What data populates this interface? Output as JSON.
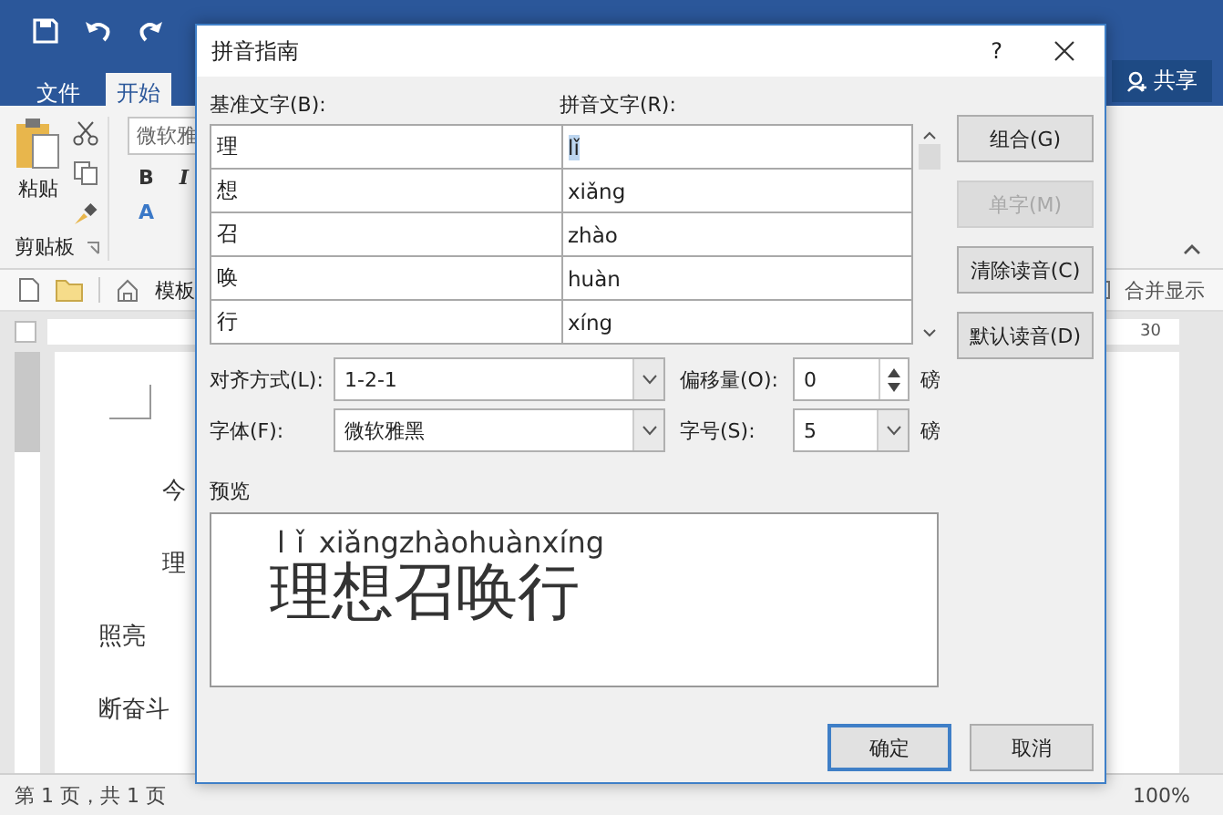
{
  "word": {
    "tabs": [
      {
        "label": "文件",
        "selected": false
      },
      {
        "label": "开始",
        "selected": true
      }
    ],
    "share": "共享",
    "paste": "粘贴",
    "clipboard_group": "剪贴板",
    "font_box": "微软雅",
    "format_buttons": [
      "B",
      "I",
      "A"
    ],
    "template": "模板",
    "merge_display": "合并显示",
    "ruler_number": "30",
    "document_lines": [
      "今",
      "理",
      "照亮",
      "断奋斗"
    ],
    "status_page": "第 1 页，共 1 页",
    "zoom": "100%"
  },
  "dialog": {
    "title": "拼音指南",
    "help": "?",
    "base_label": "基准文字(B):",
    "pinyin_label": "拼音文字(R):",
    "rows": [
      {
        "base": "理",
        "pinyin": "lǐ",
        "selected": true
      },
      {
        "base": "想",
        "pinyin": "xiǎng",
        "selected": false
      },
      {
        "base": "召",
        "pinyin": "zhào",
        "selected": false
      },
      {
        "base": "唤",
        "pinyin": "huàn",
        "selected": false
      },
      {
        "base": "行",
        "pinyin": "xíng",
        "selected": false
      }
    ],
    "buttons": [
      {
        "label": "组合(G)",
        "disabled": false
      },
      {
        "label": "单字(M)",
        "disabled": true
      },
      {
        "label": "清除读音(C)",
        "disabled": false
      },
      {
        "label": "默认读音(D)",
        "disabled": false
      }
    ],
    "align": {
      "label": "对齐方式(L):",
      "value": "1-2-1"
    },
    "offset": {
      "label": "偏移量(O):",
      "value": "0",
      "unit": "磅"
    },
    "font": {
      "label": "字体(F):",
      "value": "微软雅黑"
    },
    "size": {
      "label": "字号(S):",
      "value": "5",
      "unit": "磅"
    },
    "preview_label": "预览",
    "preview": {
      "pinyin": [
        "lǐ",
        "xiǎng",
        "zhào",
        "huàn",
        "xíng"
      ],
      "characters": [
        "理",
        "想",
        "召",
        "唤",
        "行"
      ]
    },
    "ok": "确定",
    "cancel": "取消"
  }
}
